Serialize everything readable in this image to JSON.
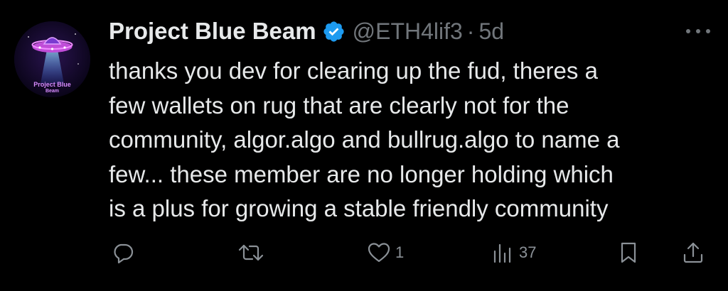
{
  "author": {
    "display_name": "Project Blue Beam",
    "handle": "@ETH4lif3",
    "separator": "·",
    "time": "5d",
    "avatar_text_line1": "Project Blue",
    "avatar_text_line2": "Beam",
    "verified_color": "#1d9bf0"
  },
  "tweet": {
    "text": "thanks you dev for clearing up the fud, theres a\nfew wallets on rug that are clearly not for the\ncommunity, algor.algo and bullrug.algo to name a\nfew... these member are no longer holding which\nis a plus for growing a stable friendly community"
  },
  "actions": {
    "reply_count": "",
    "retweet_count": "",
    "like_count": "1",
    "view_count": "37"
  },
  "icons": {
    "more": "more-dots-icon",
    "reply": "reply-icon",
    "retweet": "retweet-icon",
    "like": "heart-icon",
    "views": "views-icon",
    "bookmark": "bookmark-icon",
    "share": "share-icon"
  },
  "colors": {
    "background": "#000000",
    "text": "#e7e9ea",
    "secondary": "#71767b",
    "verified": "#1d9bf0"
  }
}
